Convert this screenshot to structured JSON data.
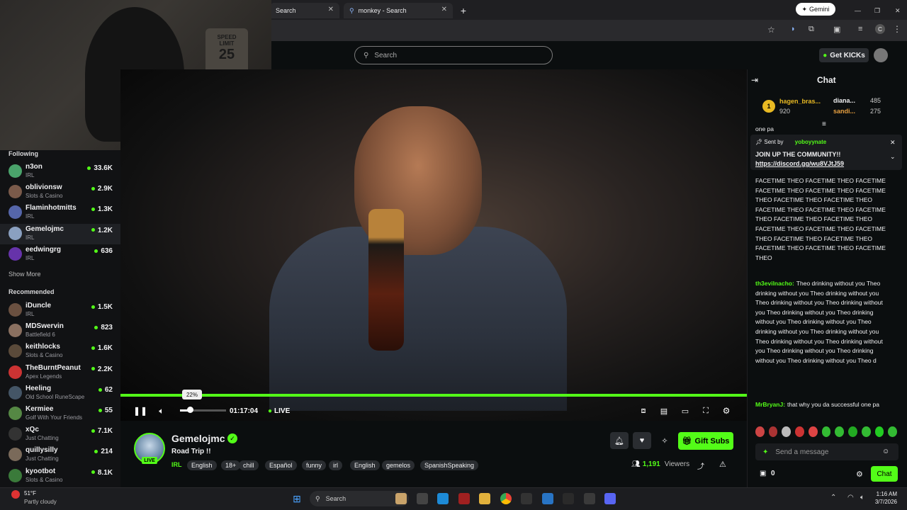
{
  "browser": {
    "tabs": [
      {
        "label": "Search"
      },
      {
        "label": "monkey - Search"
      }
    ],
    "new_tab": "+",
    "gemini_label": "Gemini"
  },
  "kick_header": {
    "search_placeholder": "Search",
    "get_kicks_label": "Get KICKs"
  },
  "sidebar": {
    "following_heading": "Following",
    "following": [
      {
        "name": "n3on",
        "category": "IRL",
        "viewers": "33.6K",
        "color": "#4aa36b"
      },
      {
        "name": "oblivionsw",
        "category": "Slots & Casino",
        "viewers": "2.9K",
        "color": "#7a5a4a"
      },
      {
        "name": "Flaminhotmitts",
        "category": "IRL",
        "viewers": "1.3K",
        "color": "#5566aa"
      },
      {
        "name": "Gemelojmc",
        "category": "IRL",
        "viewers": "1.2K",
        "color": "#8aa0c0"
      },
      {
        "name": "eedwingrg",
        "category": "IRL",
        "viewers": "636",
        "color": "#6633aa"
      }
    ],
    "show_more": "Show More",
    "recommended_heading": "Recommended",
    "recommended": [
      {
        "name": "iDuncle",
        "category": "IRL",
        "viewers": "1.5K",
        "color": "#6a5040"
      },
      {
        "name": "MDSwervin",
        "category": "Battlefield 6",
        "viewers": "823",
        "color": "#8a7060"
      },
      {
        "name": "keithlocks",
        "category": "Slots & Casino",
        "viewers": "1.6K",
        "color": "#5a4a3a"
      },
      {
        "name": "TheBurntPeanut",
        "category": "Apex Legends",
        "viewers": "2.2K",
        "color": "#cc3333"
      },
      {
        "name": "Heeling",
        "category": "Old School RuneScape",
        "viewers": "62",
        "color": "#445566"
      },
      {
        "name": "Kermiee",
        "category": "Golf With Your Friends",
        "viewers": "55",
        "color": "#558844"
      },
      {
        "name": "xQc",
        "category": "Just Chatting",
        "viewers": "7.1K",
        "color": "#333333"
      },
      {
        "name": "quillysilly",
        "category": "Just Chatting",
        "viewers": "214",
        "color": "#7a6a5a"
      },
      {
        "name": "kyootbot",
        "category": "Slots & Casino",
        "viewers": "8.1K",
        "color": "#3a7a3a"
      }
    ]
  },
  "player": {
    "progress": 1.0,
    "volume_tooltip": "22%",
    "volume_level": 0.22,
    "elapsed": "01:17:04",
    "live_label": "LIVE"
  },
  "stream": {
    "channel": "Gemelojmc",
    "title": "Road Trip !!",
    "live_badge": "LIVE",
    "category": "IRL",
    "tags": [
      "English",
      "18+",
      "chill",
      "Español",
      "funny",
      "irl",
      "English",
      "gemelos",
      "SpanishSpeaking"
    ],
    "viewers": "1,191",
    "viewers_label": "Viewers",
    "gift_subs_label": "Gift Subs"
  },
  "chat": {
    "heading": "Chat",
    "leaders": [
      {
        "rank": "1",
        "name": "hagen_bras...",
        "score": "920"
      },
      {
        "name": "diana...",
        "score": "485"
      },
      {
        "name": "sandi...",
        "score": "275"
      }
    ],
    "pinned": {
      "sent_by": "Sent by",
      "user": "yoboyynate",
      "line1": "JOIN UP THE COMMUNITY!!",
      "link": "https://discord.gg/wu8VJtJ59"
    },
    "cut_line": "one pa",
    "spam_text": "FACETIME THEO FACETIME THEO FACETIME FACETIME THEO FACETIME THEO FACETIME THEO FACETIME THEO FACETIME THEO FACETIME THEO FACETIME THEO FACETIME THEO FACETIME THEO FACETIME THEO FACETIME THEO FACETIME THEO FACETIME THEO FACETIME THEO FACETIME THEO FACETIME THEO FACETIME THEO FACETIME THEO",
    "msg2_user": "th3evilnacho:",
    "msg2_text": "Theo drinking without you Theo drinking without you Theo drinking without you Theo drinking without you Theo drinking without you Theo drinking without you Theo drinking without you Theo drinking without you Theo drinking without you Theo drinking without you Theo drinking without you Theo drinking without you Theo drinking without you Theo drinking without you Theo drinking without you Theo d",
    "msg3_user": "MrBryanJ:",
    "msg3_text": "that why you da successful one pa",
    "input_placeholder": "Send a message",
    "coin_count": "0",
    "chat_button": "Chat"
  },
  "taskbar": {
    "weather_temp": "51°F",
    "weather_desc": "Partly cloudy",
    "search_label": "Search",
    "time": "1:16 AM",
    "date": "3/7/2026"
  }
}
